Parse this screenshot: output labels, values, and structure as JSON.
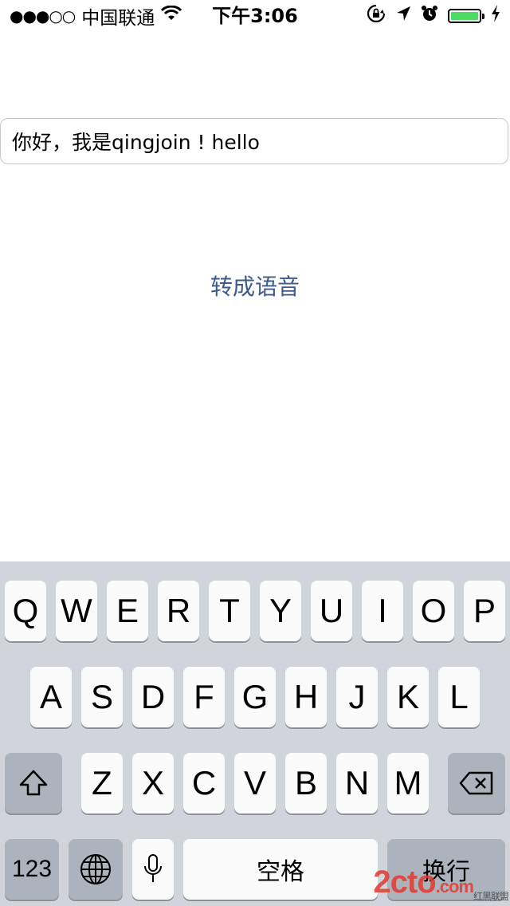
{
  "status_bar": {
    "signal_dots": "●●●○○",
    "carrier": "中国联通",
    "time": "下午3:06",
    "icons": [
      "wifi-icon",
      "orientation-lock-icon",
      "location-arrow-icon",
      "alarm-icon",
      "battery-icon",
      "charging-bolt-icon"
    ],
    "battery_color": "#4cd964"
  },
  "textfield": {
    "value": "你好，我是qingjoin ! hello"
  },
  "speak_button": {
    "label": "转成语音",
    "color": "#3c5a8c"
  },
  "keyboard": {
    "row1": [
      "Q",
      "W",
      "E",
      "R",
      "T",
      "Y",
      "U",
      "I",
      "O",
      "P"
    ],
    "row2": [
      "A",
      "S",
      "D",
      "F",
      "G",
      "H",
      "J",
      "K",
      "L"
    ],
    "row3": [
      "Z",
      "X",
      "C",
      "V",
      "B",
      "N",
      "M"
    ],
    "numbers_label": "123",
    "space_label": "空格",
    "return_label": "换行"
  },
  "watermark": {
    "text": "2cto",
    "suffix": ".com",
    "sub": "红黑联盟"
  }
}
